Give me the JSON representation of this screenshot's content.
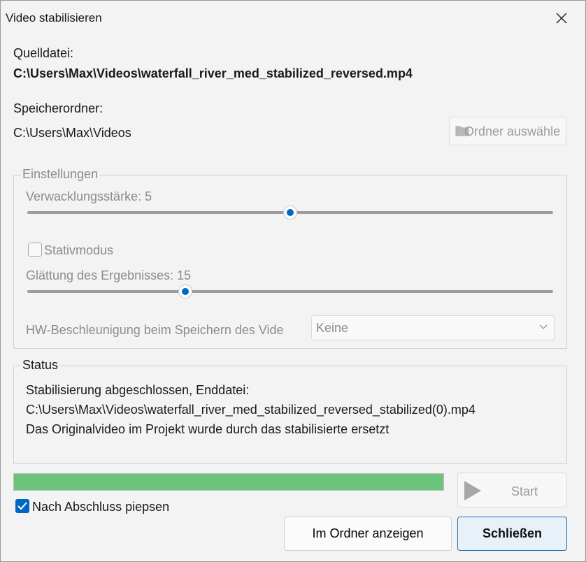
{
  "window": {
    "title": "Video stabilisieren"
  },
  "source": {
    "label": "Quelldatei:",
    "path": "C:\\Users\\Max\\Videos\\waterfall_river_med_stabilized_reversed.mp4"
  },
  "target": {
    "label": "Speicherordner:",
    "path": "C:\\Users\\Max\\Videos",
    "choose_button": "Ordner auswähle"
  },
  "settings": {
    "legend": "Einstellungen",
    "shake_label": "Verwacklungsstärke: 5",
    "shake_value": 5,
    "shake_max": 10,
    "tripod_label": "Stativmodus",
    "tripod_checked": false,
    "smooth_label": "Glättung des Ergebnisses: 15",
    "smooth_value": 15,
    "smooth_max": 50,
    "hw_label": "HW-Beschleunigung beim Speichern des Vide",
    "hw_value": "Keine"
  },
  "status": {
    "legend": "Status",
    "line1": "Stabilisierung abgeschlossen, Enddatei:",
    "line2": "C:\\Users\\Max\\Videos\\waterfall_river_med_stabilized_reversed_stabilized(0).mp4",
    "line3": "Das Originalvideo im Projekt wurde durch das stabilisierte ersetzt"
  },
  "progress": {
    "fraction": 1.0
  },
  "start_button": "Start",
  "beep": {
    "label": "Nach Abschluss piepsen",
    "checked": true
  },
  "buttons": {
    "show_in_folder": "Im Ordner anzeigen",
    "close": "Schließen"
  },
  "colors": {
    "accent": "#0067c0",
    "progress": "#6cc37b"
  }
}
